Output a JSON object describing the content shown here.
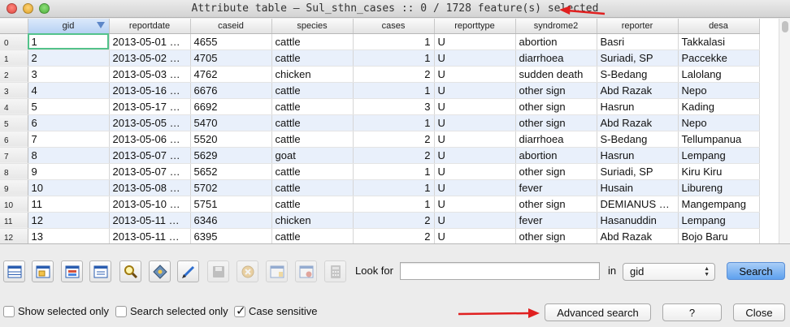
{
  "window": {
    "title": "Attribute table – Sul_sthn_cases :: 0 / 1728 feature(s) selected"
  },
  "table": {
    "columns": [
      "gid",
      "reportdate",
      "caseid",
      "species",
      "cases",
      "reporttype",
      "syndrome2",
      "reporter",
      "desa"
    ],
    "rows": [
      {
        "n": "0",
        "gid": "1",
        "reportdate": "2013-05-01 …",
        "caseid": "4655",
        "species": "cattle",
        "cases": "1",
        "reporttype": "U",
        "syndrome2": "abortion",
        "reporter": "Basri",
        "desa": "Takkalasi"
      },
      {
        "n": "1",
        "gid": "2",
        "reportdate": "2013-05-02 …",
        "caseid": "4705",
        "species": "cattle",
        "cases": "1",
        "reporttype": "U",
        "syndrome2": "diarrhoea",
        "reporter": "Suriadi, SP",
        "desa": "Paccekke"
      },
      {
        "n": "2",
        "gid": "3",
        "reportdate": "2013-05-03 …",
        "caseid": "4762",
        "species": "chicken",
        "cases": "2",
        "reporttype": "U",
        "syndrome2": "sudden death",
        "reporter": "S-Bedang",
        "desa": "Lalolang"
      },
      {
        "n": "3",
        "gid": "4",
        "reportdate": "2013-05-16 …",
        "caseid": "6676",
        "species": "cattle",
        "cases": "1",
        "reporttype": "U",
        "syndrome2": "other sign",
        "reporter": "Abd Razak",
        "desa": "Nepo"
      },
      {
        "n": "4",
        "gid": "5",
        "reportdate": "2013-05-17 …",
        "caseid": "6692",
        "species": "cattle",
        "cases": "3",
        "reporttype": "U",
        "syndrome2": "other sign",
        "reporter": "Hasrun",
        "desa": "Kading"
      },
      {
        "n": "5",
        "gid": "6",
        "reportdate": "2013-05-05 …",
        "caseid": "5470",
        "species": "cattle",
        "cases": "1",
        "reporttype": "U",
        "syndrome2": "other sign",
        "reporter": "Abd Razak",
        "desa": "Nepo"
      },
      {
        "n": "6",
        "gid": "7",
        "reportdate": "2013-05-06 …",
        "caseid": "5520",
        "species": "cattle",
        "cases": "2",
        "reporttype": "U",
        "syndrome2": "diarrhoea",
        "reporter": "S-Bedang",
        "desa": "Tellumpanua"
      },
      {
        "n": "7",
        "gid": "8",
        "reportdate": "2013-05-07 …",
        "caseid": "5629",
        "species": "goat",
        "cases": "2",
        "reporttype": "U",
        "syndrome2": "abortion",
        "reporter": "Hasrun",
        "desa": "Lempang"
      },
      {
        "n": "8",
        "gid": "9",
        "reportdate": "2013-05-07 …",
        "caseid": "5652",
        "species": "cattle",
        "cases": "1",
        "reporttype": "U",
        "syndrome2": "other sign",
        "reporter": "Suriadi, SP",
        "desa": "Kiru Kiru"
      },
      {
        "n": "9",
        "gid": "10",
        "reportdate": "2013-05-08 …",
        "caseid": "5702",
        "species": "cattle",
        "cases": "1",
        "reporttype": "U",
        "syndrome2": "fever",
        "reporter": "Husain",
        "desa": "Libureng"
      },
      {
        "n": "10",
        "gid": "11",
        "reportdate": "2013-05-10 …",
        "caseid": "5751",
        "species": "cattle",
        "cases": "1",
        "reporttype": "U",
        "syndrome2": "other sign",
        "reporter": "DEMIANUS …",
        "desa": "Mangempang"
      },
      {
        "n": "11",
        "gid": "12",
        "reportdate": "2013-05-11 …",
        "caseid": "6346",
        "species": "chicken",
        "cases": "2",
        "reporttype": "U",
        "syndrome2": "fever",
        "reporter": "Hasanuddin",
        "desa": "Lempang"
      },
      {
        "n": "12",
        "gid": "13",
        "reportdate": "2013-05-11 …",
        "caseid": "6395",
        "species": "cattle",
        "cases": "2",
        "reporttype": "U",
        "syndrome2": "other sign",
        "reporter": "Abd Razak",
        "desa": "Bojo Baru"
      }
    ]
  },
  "toolbar": {
    "icons": [
      "table-icon",
      "form-icon",
      "column-icon",
      "window-icon",
      "zoom-icon",
      "pan-icon",
      "edit-pencil-icon",
      "save-icon",
      "delete-icon",
      "new-column-icon",
      "delete-column-icon",
      "calculator-icon"
    ]
  },
  "search": {
    "look_for_label": "Look for",
    "value": "",
    "in_label": "in",
    "field": "gid",
    "button": "Search"
  },
  "options": {
    "show_selected_only": "Show selected only",
    "search_selected_only": "Search selected only",
    "case_sensitive": "Case sensitive"
  },
  "buttons": {
    "advanced": "Advanced search",
    "help": "?",
    "close": "Close"
  },
  "colors": {
    "annotation_arrow": "#e02020",
    "focus_cell": "#53c28b",
    "alt_row": "#e9f0fb"
  }
}
